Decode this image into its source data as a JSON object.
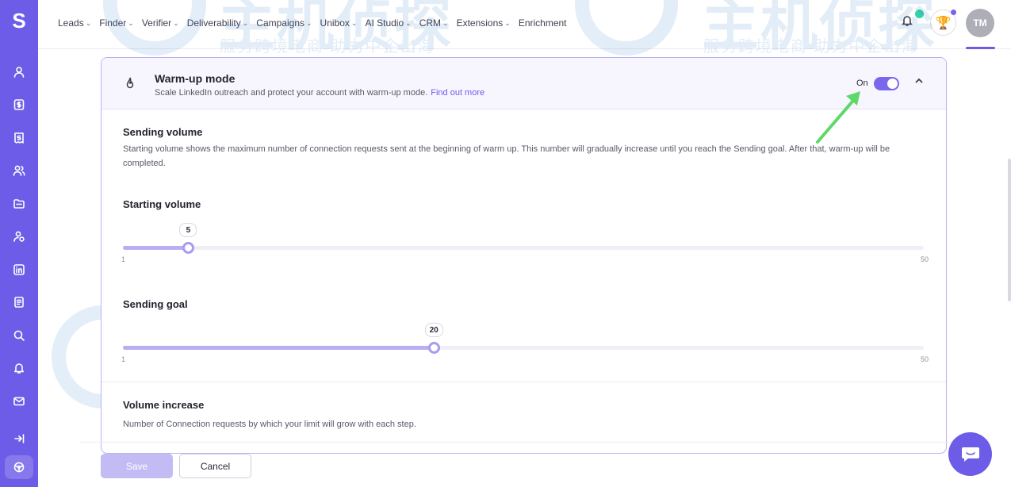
{
  "app": {
    "logo_letter": "S"
  },
  "sidebar": {
    "items": [
      {
        "icon": "user-icon"
      },
      {
        "icon": "dollar-doc-icon"
      },
      {
        "icon": "invoice-icon"
      },
      {
        "icon": "users-icon"
      },
      {
        "icon": "folder-icon"
      },
      {
        "icon": "contacts-icon"
      },
      {
        "icon": "linkedin-icon"
      },
      {
        "icon": "document-icon"
      },
      {
        "icon": "search-icon"
      },
      {
        "icon": "bell-icon"
      },
      {
        "icon": "mail-icon"
      },
      {
        "icon": "logout-icon"
      },
      {
        "icon": "integrations-icon"
      }
    ]
  },
  "nav": {
    "items": [
      {
        "label": "Leads",
        "dropdown": true
      },
      {
        "label": "Finder",
        "dropdown": true
      },
      {
        "label": "Verifier",
        "dropdown": true
      },
      {
        "label": "Deliverability",
        "dropdown": true
      },
      {
        "label": "Campaigns",
        "dropdown": true
      },
      {
        "label": "Unibox",
        "dropdown": true
      },
      {
        "label": "AI Studio",
        "dropdown": true
      },
      {
        "label": "CRM",
        "dropdown": true
      },
      {
        "label": "Extensions",
        "dropdown": true
      },
      {
        "label": "Enrichment",
        "dropdown": false
      }
    ],
    "avatar_initials": "TM",
    "trophy_glyph": "🏆"
  },
  "warmup": {
    "title": "Warm-up mode",
    "subtitle": "Scale LinkedIn outreach and protect your account with warm-up mode.",
    "link": "Find out more",
    "toggle_label": "On",
    "toggle_on": true
  },
  "sending_volume": {
    "title": "Sending volume",
    "description": "Starting volume shows the maximum number of connection requests sent at the beginning of warm up. This number will gradually increase until you reach the Sending goal. After that, warm-up will be completed."
  },
  "starting_volume": {
    "title": "Starting volume",
    "value": "5",
    "value_num": 5,
    "min": "1",
    "max": "50"
  },
  "sending_goal": {
    "title": "Sending goal",
    "value": "20",
    "value_num": 20,
    "min": "1",
    "max": "50"
  },
  "volume_increase": {
    "title": "Volume increase",
    "description": "Number of Connection requests by which your limit will grow with each step."
  },
  "footer": {
    "save_label": "Save",
    "cancel_label": "Cancel"
  },
  "watermark": {
    "title": "主机侦探",
    "subtitle": "服务跨境电商 助力中企出海"
  },
  "colors": {
    "accent": "#6d5ce7",
    "slider_fill": "#b8aff2",
    "arrow": "#5fd86a"
  }
}
